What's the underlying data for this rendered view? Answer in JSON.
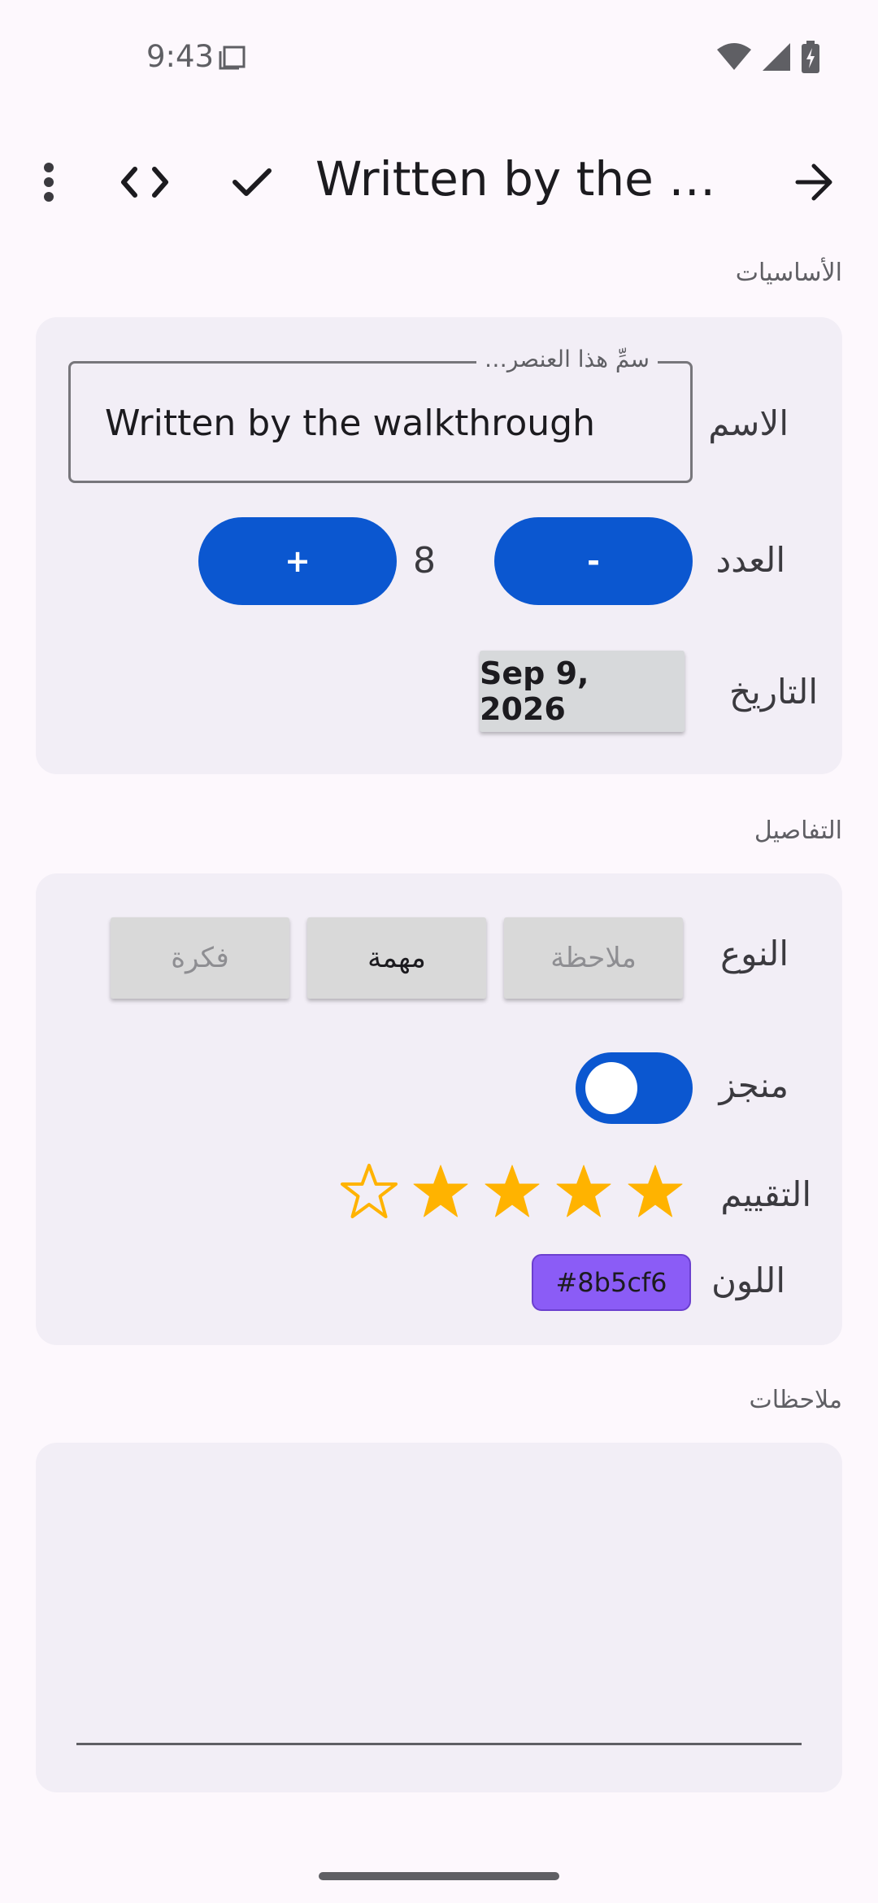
{
  "status_bar": {
    "time": "9:43"
  },
  "toolbar": {
    "title": "Written by the wal…"
  },
  "sections": {
    "basics_label": "الأساسيات",
    "details_label": "التفاصيل",
    "notes_label": "ملاحظات"
  },
  "basics": {
    "name_label": "الاسم",
    "name_placeholder": "سمِّ هذا العنصر…",
    "name_value": "Written by the walkthrough",
    "count_label": "العدد",
    "count_value": "8",
    "plus_label": "+",
    "minus_label": "-",
    "date_label": "التاريخ",
    "date_value": "Sep 9, 2026"
  },
  "details": {
    "type_label": "النوع",
    "type_options": [
      "ملاحظة",
      "مهمة",
      "فكرة"
    ],
    "type_selected": "مهمة",
    "done_label": "منجز",
    "done_on": true,
    "rating_label": "التقييم",
    "rating_value": 4,
    "rating_max": 5,
    "color_label": "اللون",
    "color_value": "#8b5cf6"
  },
  "notes": {
    "value": ""
  },
  "colors": {
    "accent": "#0b57d0",
    "star": "#ffb300",
    "chip": "#8b5cf6"
  }
}
